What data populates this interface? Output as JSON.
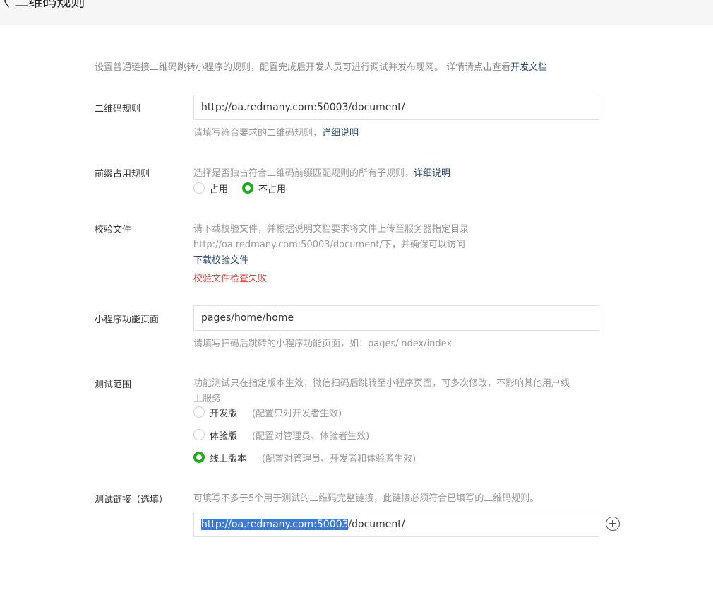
{
  "header": {
    "title": "〈 二维码规则"
  },
  "intro": {
    "text": "设置普通链接二维码跳转小程序的规则，配置完成后开发人员可进行调试并发布现网。 详情请点击查看",
    "link": "开发文档"
  },
  "qr_rule": {
    "label": "二维码规则",
    "value": "http://oa.redmany.com:50003/document/",
    "tip": "请填写符合要求的二维码规则，",
    "tip_link": "详细说明"
  },
  "prefix": {
    "label": "前缀占用规则",
    "tip": "选择是否独占符合二维码前缀匹配规则的所有子规则，",
    "tip_link": "详细说明",
    "options": [
      "占用",
      "不占用"
    ],
    "selected": "不占用"
  },
  "verify": {
    "label": "校验文件",
    "line1": "请下载校验文件，并根据说明文档要求将文件上传至服务器指定目录",
    "line2": "http://oa.redmany.com:50003/document/下，并确保可以访问",
    "download": "下载校验文件",
    "error": "校验文件检查失败"
  },
  "page": {
    "label": "小程序功能页面",
    "value": "pages/home/home",
    "tip": "请填写扫码后跳转的小程序功能页面，如：pages/index/index"
  },
  "scope": {
    "label": "测试范围",
    "tip_line1": "功能测试只在指定版本生效，微信扫码后跳转至小程序页面，可多次修改，不影响其他用户线",
    "tip_line2": "上服务",
    "options": [
      {
        "label": "开发版",
        "note": "(配置只对开发者生效)"
      },
      {
        "label": "体验版",
        "note": "(配置对管理员、体验者生效)"
      },
      {
        "label": "线上版本",
        "note": "(配置对管理员、开发者和体验者生效)"
      }
    ],
    "selected": "线上版本"
  },
  "test_link": {
    "label": "测试链接（选填）",
    "tip": "可填写不多于5个用于测试的二维码完整链接，此链接必须符合已填写的二维码规则。",
    "value_selected": "http://oa.redmany.com:50003",
    "value_rest": "/document/"
  },
  "icons": {
    "add": "plus-circle-icon"
  }
}
